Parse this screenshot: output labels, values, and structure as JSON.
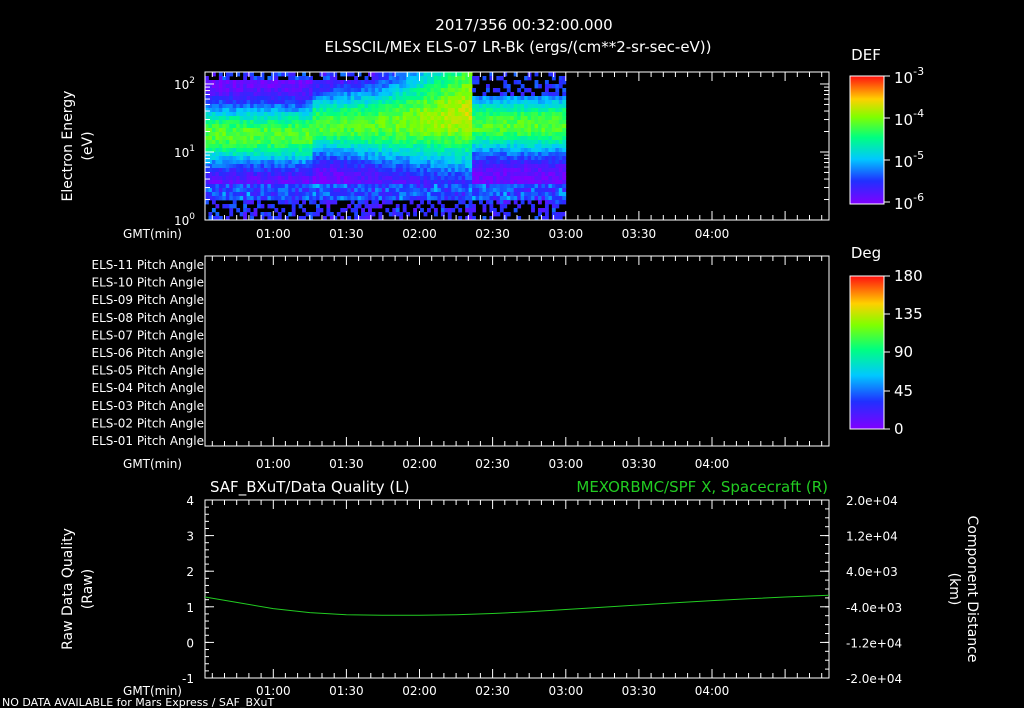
{
  "header": {
    "timestamp": "2017/356 00:32:00.000",
    "subtitle": "ELSSCIL/MEx ELS-07 LR-Bk  (ergs/(cm**2-sr-sec-eV))"
  },
  "time_axis": {
    "label": "GMT(min)",
    "range": [
      "00:32",
      "04:48"
    ],
    "ticks": [
      "01:00",
      "01:30",
      "02:00",
      "02:30",
      "03:00",
      "03:30",
      "04:00"
    ]
  },
  "colors": {
    "background": "#000000",
    "axes": "#ffffff",
    "right_series": "#22cc22"
  },
  "footer": {
    "text": "NO DATA AVAILABLE for Mars Express / SAF_BXuT"
  },
  "chart_data": [
    {
      "type": "heatmap",
      "title": "ELSSCIL/MEx ELS-07 LR-Bk  (ergs/(cm**2-sr-sec-eV))",
      "ylabel": [
        "Electron Energy",
        "(eV)"
      ],
      "ylog": true,
      "ylim": [
        1,
        150
      ],
      "yticks": [
        {
          "base": "10",
          "exp": "0",
          "value": 1
        },
        {
          "base": "10",
          "exp": "1",
          "value": 10
        },
        {
          "base": "10",
          "exp": "2",
          "value": 100
        }
      ],
      "data_end": "03:00",
      "colorbar": {
        "title": "DEF",
        "log": true,
        "range": [
          1e-06,
          0.001
        ],
        "ticks": [
          {
            "base": "10",
            "exp": "-3"
          },
          {
            "base": "10",
            "exp": "-4"
          },
          {
            "base": "10",
            "exp": "-5"
          },
          {
            "base": "10",
            "exp": "-6"
          }
        ]
      }
    },
    {
      "type": "heatmap",
      "ylabels": [
        "ELS-11 Pitch Angle",
        "ELS-10 Pitch Angle",
        "ELS-09 Pitch Angle",
        "ELS-08 Pitch Angle",
        "ELS-07 Pitch Angle",
        "ELS-06 Pitch Angle",
        "ELS-05 Pitch Angle",
        "ELS-04 Pitch Angle",
        "ELS-03 Pitch Angle",
        "ELS-02 Pitch Angle",
        "ELS-01 Pitch Angle"
      ],
      "colorbar": {
        "title": "Deg",
        "range": [
          0,
          180
        ],
        "ticks": [
          "180",
          "135",
          "90",
          "45",
          "0"
        ]
      }
    },
    {
      "type": "line",
      "left_title": "SAF_BXuT/Data Quality (L)",
      "right_title": "MEXORBMC/SPF X, Spacecraft (R)",
      "ylabel_left": [
        "Raw Data Quality",
        "(Raw)"
      ],
      "ylabel_right": [
        "Component Distance",
        "(km)"
      ],
      "ylim_left": [
        -1,
        4
      ],
      "yticks_left": [
        "4",
        "3",
        "2",
        "1",
        "0",
        "-1"
      ],
      "ylim_right": [
        -20000,
        20000
      ],
      "yticks_right": [
        "2.0e+04",
        "1.2e+04",
        "4.0e+03",
        "-4.0e+03",
        "-1.2e+04",
        "-2.0e+04"
      ],
      "series": [
        {
          "name": "MEXORBMC/SPF X, Spacecraft (R)",
          "axis": "right",
          "x": [
            "00:32",
            "00:45",
            "01:00",
            "01:15",
            "01:30",
            "01:45",
            "02:00",
            "02:15",
            "02:30",
            "02:45",
            "03:00",
            "03:15",
            "03:30",
            "03:45",
            "04:00",
            "04:15",
            "04:30",
            "04:48"
          ],
          "values": [
            -1800,
            -3000,
            -4400,
            -5300,
            -5800,
            -5900,
            -5900,
            -5800,
            -5500,
            -5100,
            -4600,
            -4100,
            -3600,
            -3100,
            -2600,
            -2200,
            -1800,
            -1400
          ]
        }
      ]
    }
  ]
}
